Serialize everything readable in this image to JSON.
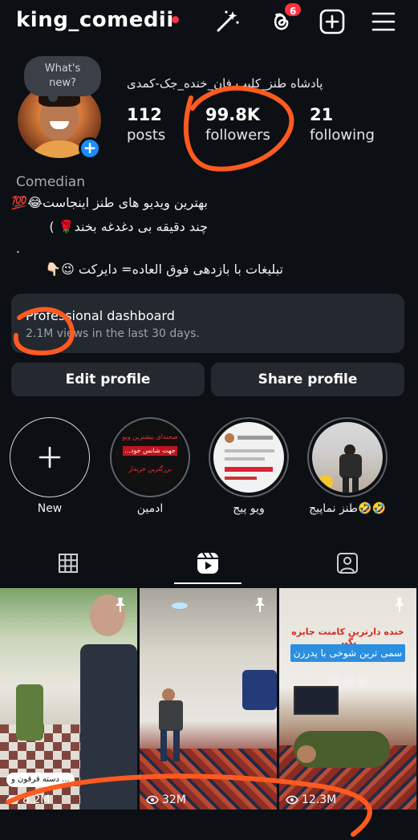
{
  "header": {
    "username": "king_comedii",
    "threads_badge": "6"
  },
  "profile": {
    "note": "What's new?",
    "full_name": "پادشاه طنز_کلیپ فان_خنده_جک-کمدی",
    "stats": [
      {
        "num": "112",
        "label": "posts"
      },
      {
        "num": "99.8K",
        "label": "followers"
      },
      {
        "num": "21",
        "label": "following"
      }
    ],
    "category": "Comedian",
    "bio": [
      "بهترین ویدیو های طنز اینجاست😂💯",
      "چند دقیقه بی دغدغه بخند🌹 )",
      ".",
      "تبلیغات با بازدهی فوق العاده= دایرکت 😉👇🏻"
    ]
  },
  "dashboard": {
    "title": "Professional dashboard",
    "subtitle": "2.1M views in the last 30 days."
  },
  "buttons": {
    "edit": "Edit profile",
    "share": "Share profile"
  },
  "highlights": [
    {
      "label": "New"
    },
    {
      "label": "ادمین",
      "line1": "صحنه‌ای بیشترین ویو",
      "line2": "جهت شانس خود...",
      "line3": "بزرگترین خریدار"
    },
    {
      "label": "ویو پیج"
    },
    {
      "label": "طنز نماپیج🤣🤣"
    }
  ],
  "posts": [
    {
      "views": "8.2M",
      "caption": "... دسته فرقون و"
    },
    {
      "views": "32M"
    },
    {
      "views": "12.3M",
      "top_text": "خنده دارترین کامنت جایزه بگیر",
      "banner": "سمی ترین شوخی با پدرزن",
      "emojis": "😂😂😂"
    }
  ],
  "icon_colors": {
    "accent": "#1a8cff",
    "badge": "#ff3040",
    "annotation": "#ff5a1f"
  }
}
